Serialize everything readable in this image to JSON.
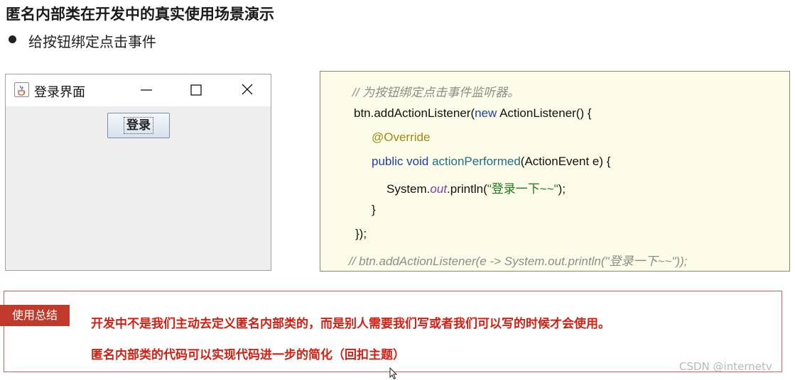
{
  "slide": {
    "title": "匿名内部类在开发中的真实使用场景演示",
    "bullet": "给按钮绑定点击事件"
  },
  "window": {
    "title": "登录界面",
    "icon": "java-cup-icon",
    "controls": [
      "minimize-icon",
      "maximize-icon",
      "close-icon"
    ],
    "button_label": "登录"
  },
  "code": {
    "comment1": "//  为按钮绑定点击事件监听器。",
    "line1_a": "btn.addActionListener(",
    "line1_kw": "new",
    "line1_b": " ActionListener() {",
    "annotation": "@Override",
    "line3_kw": "public void",
    "line3_fn": "actionPerformed",
    "line3_b": "(ActionEvent e) {",
    "line4_a": "System.",
    "line4_field": "out",
    "line4_b": ".println(",
    "line4_str": "\"登录一下~~\"",
    "line4_c": ");",
    "close_brace": "}",
    "close_call": "});",
    "comment2": "//  btn.addActionListener(e -> System.out.println(\"登录一下~~\"));"
  },
  "summary": {
    "tag": "使用总结",
    "line1": "开发中不是我们主动去定义匿名内部类的，而是别人需要我们写或者我们可以写的时候才会使用。",
    "line2": "匿名内部类的代码可以实现代码进一步的简化（回扣主题）"
  },
  "watermark": "CSDN @internetv",
  "colors": {
    "summary_red": "#d21f12",
    "tag_bg": "#c0392b",
    "code_bg": "#fdfce8",
    "keyword": "#1d3fa8",
    "string": "#1a7a1a"
  }
}
